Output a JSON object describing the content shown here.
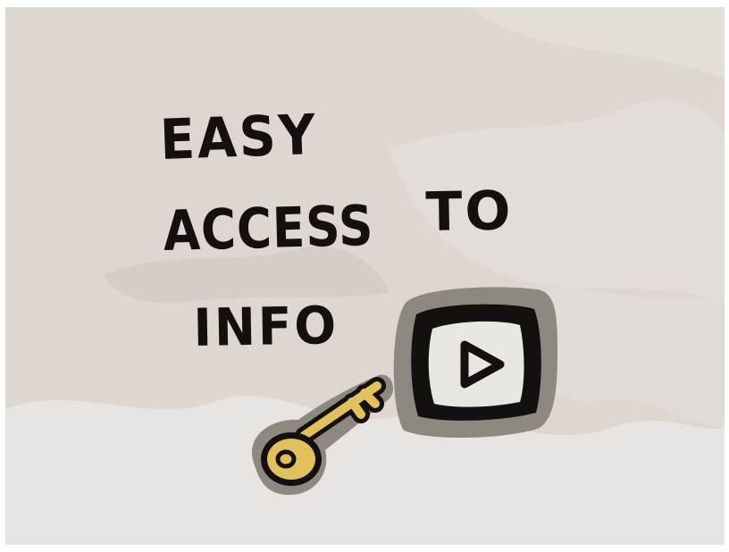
{
  "headline": {
    "line1": "EASY",
    "line2_word1": "ACCESS",
    "line2_word2": "TO",
    "line3": "INFO"
  },
  "icons": {
    "play": "play-button-icon",
    "key": "key-icon"
  },
  "colors": {
    "background": "#ddd6d1",
    "ink": "#151010",
    "key_fill": "#e3c15a",
    "shadow": "#8d8880"
  }
}
